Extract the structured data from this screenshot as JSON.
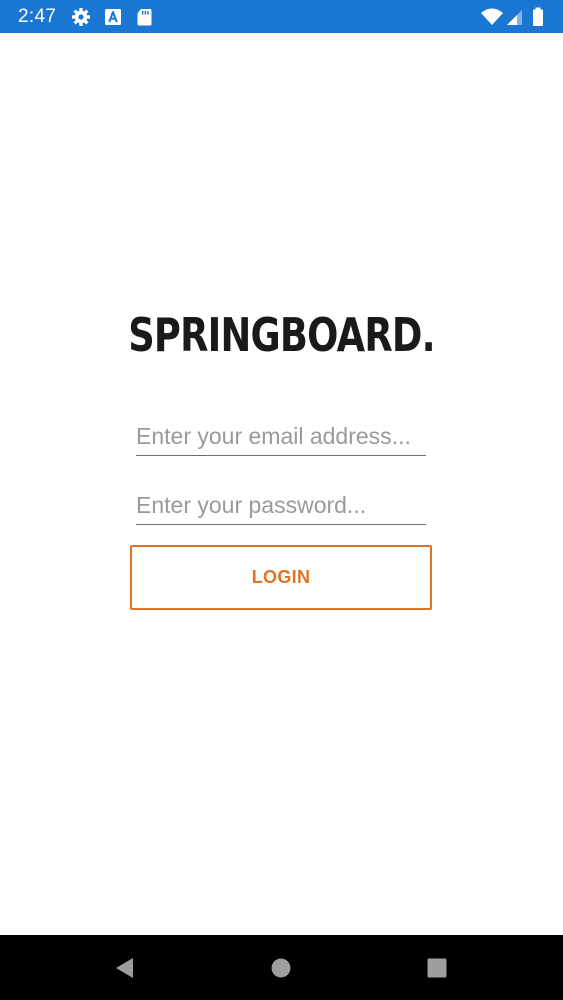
{
  "status_bar": {
    "time": "2:47",
    "icons": [
      "gear-icon",
      "font-a-icon",
      "sd-card-icon",
      "wifi-icon",
      "signal-icon",
      "battery-icon"
    ],
    "background": "#1976d2"
  },
  "app": {
    "logo_text": "SPRINGBOARD.",
    "email_placeholder": "Enter your email address...",
    "password_placeholder": "Enter your password...",
    "login_label": "LOGIN",
    "accent_color": "#e07325"
  },
  "nav_bar": {
    "buttons": [
      "back-icon",
      "home-icon",
      "recents-icon"
    ],
    "background": "#000000"
  }
}
